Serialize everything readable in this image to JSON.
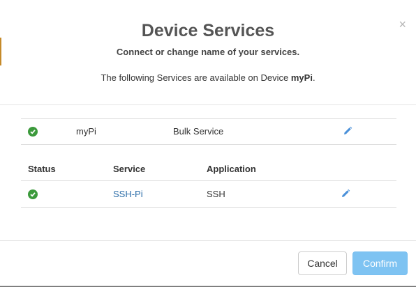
{
  "dialog": {
    "title": "Device Services",
    "subtitle": "Connect or change name of your services.",
    "info_prefix": "The following Services are available on Device ",
    "device_name": "myPi",
    "info_suffix": ".",
    "close_glyph": "×"
  },
  "device_row": {
    "status": "ok",
    "name": "myPi",
    "application": "Bulk Service"
  },
  "table": {
    "headers": {
      "status": "Status",
      "service": "Service",
      "application": "Application"
    },
    "rows": [
      {
        "status": "ok",
        "service": "SSH-Pi",
        "application": "SSH"
      }
    ]
  },
  "buttons": {
    "cancel": "Cancel",
    "confirm": "Confirm"
  },
  "colors": {
    "status_ok": "#3c9a3c",
    "link": "#2a6ca8",
    "edit_icon": "#4a90d9",
    "confirm_bg": "#7ec3f2"
  },
  "icons": {
    "status": "check-circle-icon",
    "edit": "pencil-icon",
    "close": "close-icon"
  }
}
